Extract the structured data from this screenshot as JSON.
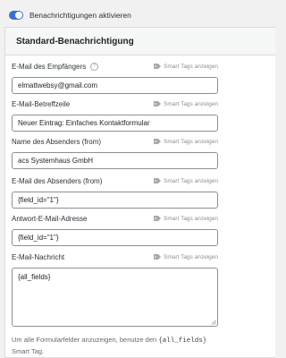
{
  "toggle": {
    "label": "Benachrichtigungen aktivieren",
    "enabled": true,
    "accent": "#3871d4"
  },
  "panel": {
    "title": "Standard-Benachrichtigung"
  },
  "smart_tags_label": "Smart Tags anzeigen",
  "fields": {
    "recipient": {
      "label": "E-Mail des Empfängers",
      "value": "elmattwebsy@gmail.com"
    },
    "subject": {
      "label": "E-Mail-Betreffzeile",
      "value": "Neuer Eintrag: Einfaches Kontaktformular"
    },
    "from_name": {
      "label": "Name des Absenders (from)",
      "value": "acs Systemhaus GmbH"
    },
    "from_email": {
      "label": "E-Mail des Absenders (from)",
      "value": "{field_id=\"1\"}"
    },
    "reply_to": {
      "label": "Antwort-E-Mail-Adresse",
      "value": "{field_id=\"1\"}"
    },
    "message": {
      "label": "E-Mail-Nachricht",
      "value": "{all_fields}"
    }
  },
  "hint": {
    "before": "Um alle Formularfelder anzuzeigen, benutze den",
    "code": "{all_fields}",
    "after": "Smart Tag."
  }
}
